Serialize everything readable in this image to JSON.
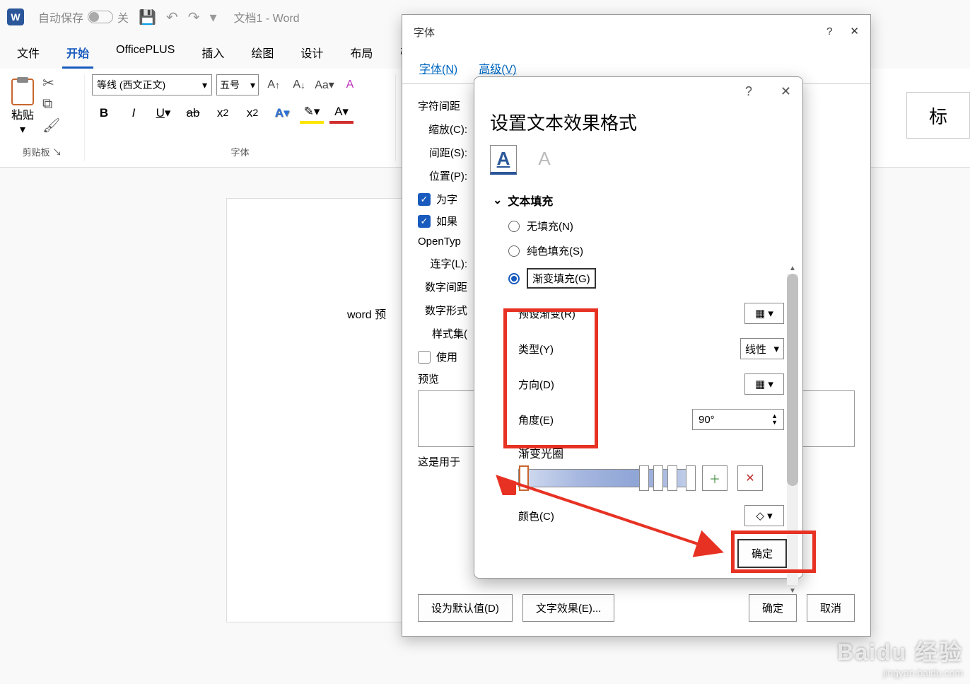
{
  "titlebar": {
    "auto_save": "自动保存",
    "toggle": "关",
    "doc": "文档1  -  Word"
  },
  "ribbon_tabs": [
    "文件",
    "开始",
    "OfficePLUS",
    "插入",
    "绘图",
    "设计",
    "布局",
    "引"
  ],
  "ribbon": {
    "paste": "粘贴",
    "clipboard_label": "剪贴板",
    "font_name": "等线 (西文正文)",
    "font_size": "五号",
    "font_label": "字体"
  },
  "document": {
    "text": "word 预"
  },
  "style_card": "标",
  "font_dialog": {
    "title": "字体",
    "tab1": "字体(N)",
    "tab2": "高级(V)",
    "section": "字符间距",
    "scale": "缩放(C):",
    "spacing": "间距(S):",
    "position": "位置(P):",
    "kern": "为字",
    "snap": "如果",
    "opentype": "OpenTyp",
    "lig": "连字(L):",
    "num_spacing": "数字间距",
    "num_form": "数字形式",
    "style_set": "样式集(",
    "use": "使用",
    "preview": "预览",
    "note": "这是用于",
    "set_default": "设为默认值(D)",
    "text_effect": "文字效果(E)...",
    "ok": "确定",
    "cancel": "取消"
  },
  "effect_dialog": {
    "title": "设置文本效果格式",
    "section": "文本填充",
    "r1": "无填充(N)",
    "r2": "纯色填充(S)",
    "r3": "渐变填充(G)",
    "preset": "预设渐变(R)",
    "type": "类型(Y)",
    "type_val": "线性",
    "direction": "方向(D)",
    "angle": "角度(E)",
    "angle_val": "90°",
    "stops": "渐变光圈",
    "color": "颜色(C)",
    "ok": "确定"
  },
  "watermark": {
    "brand": "Baidu 经验",
    "url": "jingyan.baidu.com"
  }
}
